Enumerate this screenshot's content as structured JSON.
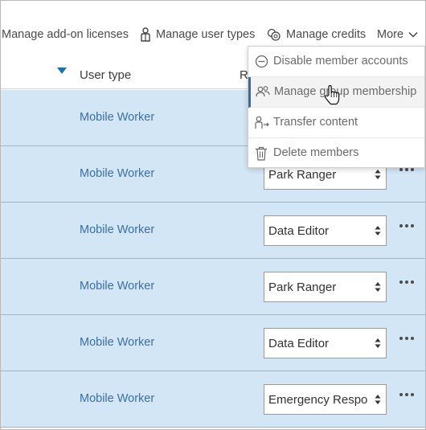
{
  "toolbar": {
    "addon_label": "Manage add-on licenses",
    "usertypes_label": "Manage user types",
    "credits_label": "Manage credits",
    "more_label": "More"
  },
  "table": {
    "columns": [
      "User type",
      "Role"
    ],
    "sort_indicator": "sort-descending-icon",
    "rows": [
      {
        "user_type": "Mobile Worker",
        "role": ""
      },
      {
        "user_type": "Mobile Worker",
        "role": "Park Ranger"
      },
      {
        "user_type": "Mobile Worker",
        "role": "Data Editor"
      },
      {
        "user_type": "Mobile Worker",
        "role": "Park Ranger"
      },
      {
        "user_type": "Mobile Worker",
        "role": "Data Editor"
      },
      {
        "user_type": "Mobile Worker",
        "role": "Emergency Respo"
      }
    ]
  },
  "more_menu": {
    "items": [
      {
        "label": "Disable member accounts",
        "icon": "minus-circle-icon"
      },
      {
        "label": "Manage group membership",
        "icon": "group-icon"
      },
      {
        "label": "Transfer content",
        "icon": "transfer-user-icon"
      },
      {
        "label": "Delete members",
        "icon": "trash-icon"
      }
    ],
    "hovered_index": 1
  },
  "colors": {
    "row_selected_bg": "#d2e6f6",
    "row_border": "#8fb8dc",
    "link_text": "#3a6fa6",
    "accent": "#2a6fb0"
  }
}
